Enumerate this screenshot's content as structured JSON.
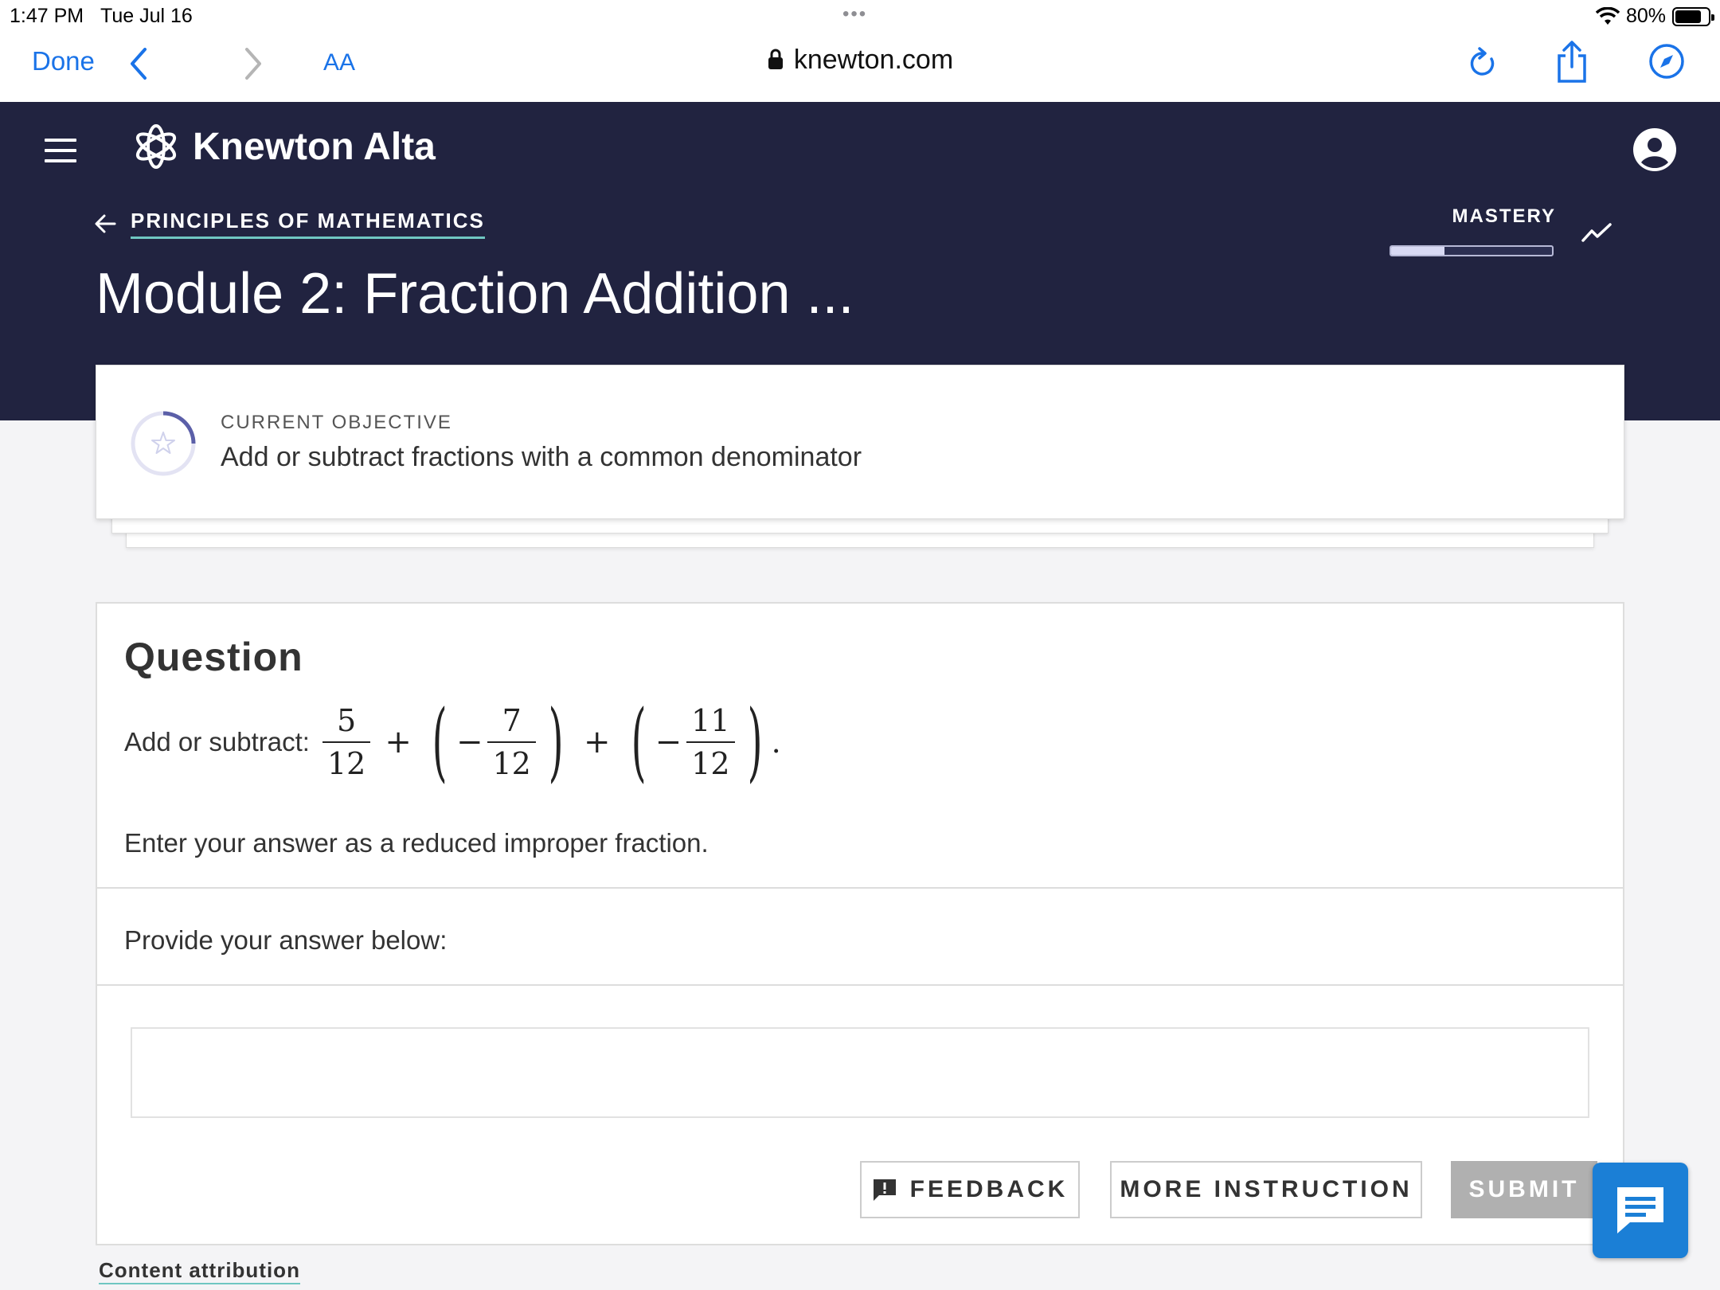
{
  "status_bar": {
    "time": "1:47 PM",
    "date": "Tue Jul 16",
    "dots": "•••",
    "battery": "80%",
    "battery_level": 0.8
  },
  "browser": {
    "done_label": "Done",
    "text_size_label": "AA",
    "url": "knewton.com"
  },
  "header": {
    "brand": "Knewton Alta",
    "breadcrumb": "PRINCIPLES OF MATHEMATICS",
    "page_title": "Module 2: Fraction Addition ...",
    "mastery_label": "MASTERY",
    "mastery_progress": 0.33
  },
  "objective": {
    "label": "CURRENT OBJECTIVE",
    "text": "Add or subtract fractions with a common denominator"
  },
  "question": {
    "title": "Question",
    "prompt": "Add or subtract:",
    "terms": [
      {
        "num": "5",
        "den": "12"
      },
      {
        "num": "7",
        "den": "12"
      },
      {
        "num": "11",
        "den": "12"
      }
    ],
    "plus": "+",
    "minus": "−",
    "period": ".",
    "instruction": "Enter your answer as a reduced improper fraction.",
    "provide_label": "Provide your answer below:",
    "answer_value": ""
  },
  "buttons": {
    "feedback": "FEEDBACK",
    "more_instruction": "MORE INSTRUCTION",
    "submit": "SUBMIT"
  },
  "footer": {
    "attribution": "Content attribution"
  },
  "colors": {
    "header_bg": "#212340",
    "accent_link": "#1a73e8",
    "underline": "#6fc6c2",
    "chat_bg": "#1b7fd6",
    "submit_disabled": "#b0b0b0"
  }
}
